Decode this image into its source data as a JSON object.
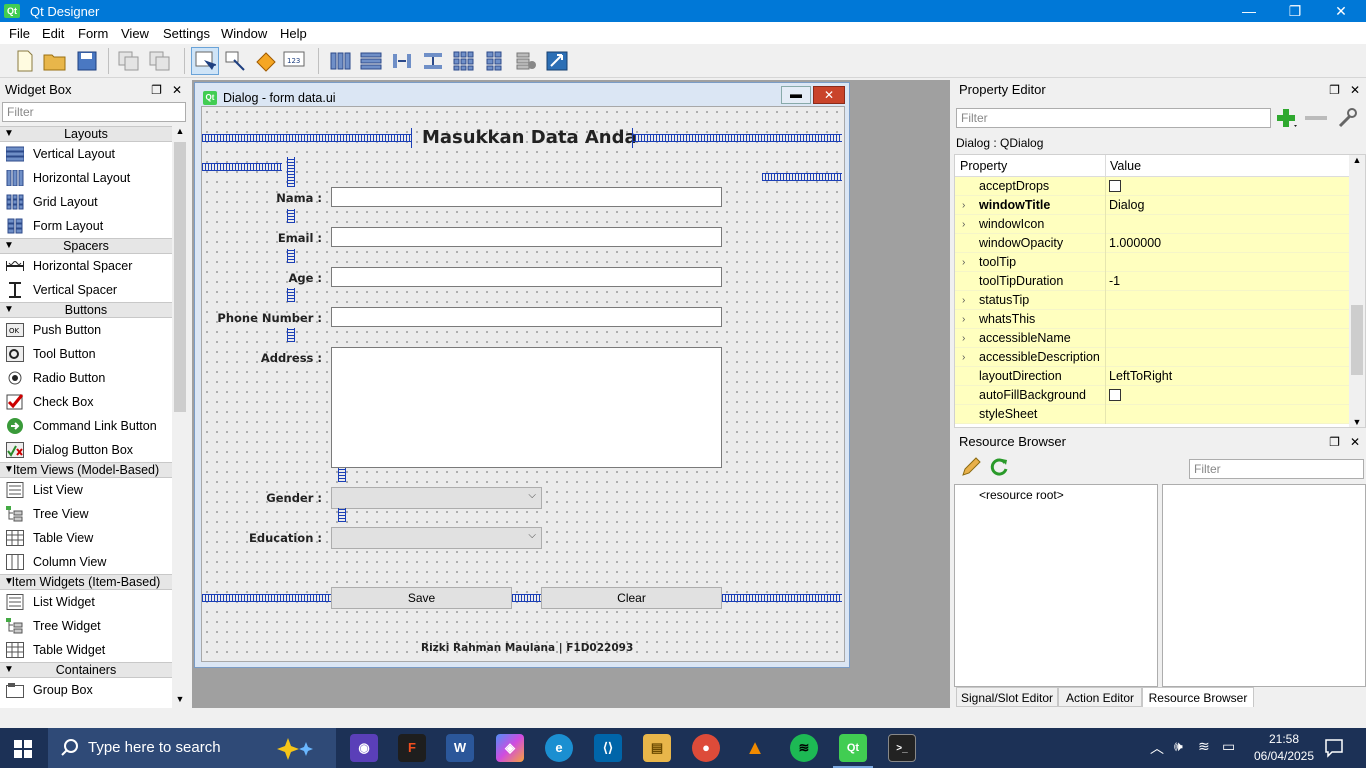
{
  "app": {
    "logo": "Qt",
    "title": "Qt Designer"
  },
  "window_controls": {
    "minimize": "—",
    "maximize": "❐",
    "close": "✕"
  },
  "menu": [
    "File",
    "Edit",
    "Form",
    "View",
    "Settings",
    "Window",
    "Help"
  ],
  "widget_box": {
    "title": "Widget Box",
    "filter_placeholder": "Filter",
    "categories": [
      {
        "label": "Layouts",
        "items": [
          "Vertical Layout",
          "Horizontal Layout",
          "Grid Layout",
          "Form Layout"
        ]
      },
      {
        "label": "Spacers",
        "items": [
          "Horizontal Spacer",
          "Vertical Spacer"
        ]
      },
      {
        "label": "Buttons",
        "items": [
          "Push Button",
          "Tool Button",
          "Radio Button",
          "Check Box",
          "Command Link Button",
          "Dialog Button Box"
        ]
      },
      {
        "label": "Item Views (Model-Based)",
        "items": [
          "List View",
          "Tree View",
          "Table View",
          "Column View"
        ]
      },
      {
        "label": "Item Widgets (Item-Based)",
        "items": [
          "List Widget",
          "Tree Widget",
          "Table Widget"
        ]
      },
      {
        "label": "Containers",
        "items": [
          "Group Box"
        ]
      }
    ]
  },
  "form_window": {
    "logo": "Qt",
    "title": "Dialog - form data.ui",
    "heading": "Masukkan Data Anda",
    "labels": {
      "nama": "Nama :",
      "email": "Email :",
      "age": "Age :",
      "phone": "Phone Number :",
      "address": "Address :",
      "gender": "Gender :",
      "education": "Education :"
    },
    "buttons": {
      "save": "Save",
      "clear": "Clear"
    },
    "footer": "Rizki Rahman Maulana | F1D022093"
  },
  "property_editor": {
    "title": "Property Editor",
    "filter_placeholder": "Filter",
    "object": "Dialog : QDialog",
    "col_property": "Property",
    "col_value": "Value",
    "rows": [
      {
        "name": "acceptDrops",
        "value": "",
        "expand": "",
        "checkbox": true
      },
      {
        "name": "windowTitle",
        "value": "Dialog",
        "expand": "›",
        "bold": true
      },
      {
        "name": "windowIcon",
        "value": "",
        "expand": "›"
      },
      {
        "name": "windowOpacity",
        "value": "1.000000",
        "expand": ""
      },
      {
        "name": "toolTip",
        "value": "",
        "expand": "›"
      },
      {
        "name": "toolTipDuration",
        "value": "-1",
        "expand": ""
      },
      {
        "name": "statusTip",
        "value": "",
        "expand": "›"
      },
      {
        "name": "whatsThis",
        "value": "",
        "expand": "›"
      },
      {
        "name": "accessibleName",
        "value": "",
        "expand": "›"
      },
      {
        "name": "accessibleDescription",
        "value": "",
        "expand": "›"
      },
      {
        "name": "layoutDirection",
        "value": "LeftToRight",
        "expand": ""
      },
      {
        "name": "autoFillBackground",
        "value": "",
        "expand": "",
        "checkbox": true
      },
      {
        "name": "styleSheet",
        "value": "",
        "expand": ""
      }
    ]
  },
  "resource_browser": {
    "title": "Resource Browser",
    "filter_placeholder": "Filter",
    "root": "<resource root>",
    "tabs": [
      "Signal/Slot Editor",
      "Action Editor",
      "Resource Browser"
    ]
  },
  "taskbar": {
    "search_placeholder": "Type here to search",
    "time": "21:58",
    "date": "06/04/2025",
    "apps": [
      "copilot",
      "figma",
      "word",
      "copilot-365",
      "edge",
      "vscode",
      "explorer",
      "chrome",
      "vlc",
      "spotify",
      "qt-designer",
      "terminal"
    ]
  },
  "colors": {
    "titlebar": "#0078d7",
    "spacer": "#1b3fb6",
    "property_row": "#ffffbf",
    "taskbar": "#1c3156",
    "qt_green": "#41cd52"
  }
}
